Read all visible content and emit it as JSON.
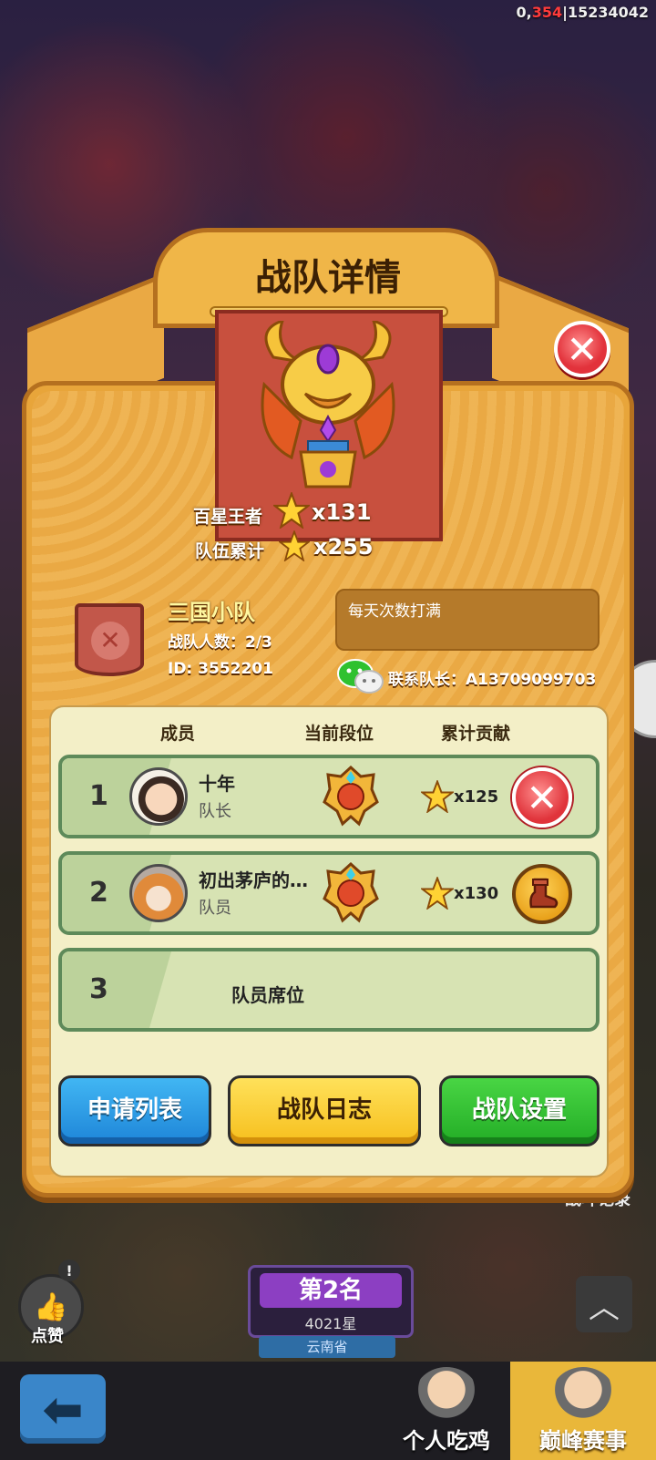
{
  "hud": {
    "counter_prefix": "0,",
    "counter_highlight": "354",
    "counter_suffix": "|15234042"
  },
  "dialog": {
    "title": "战队详情",
    "stats": [
      {
        "label": "百星王者",
        "value": "x131"
      },
      {
        "label": "队伍累计",
        "value": "x255"
      }
    ],
    "team": {
      "name": "三国小队",
      "member_count": "战队人数：2/3",
      "id": "ID: 3552201",
      "notice": "每天次数打满",
      "contact": "联系队长：A13709099703"
    },
    "columns": [
      "成员",
      "当前段位",
      "累计贡献"
    ],
    "members": [
      {
        "index": "1",
        "name": "十年",
        "role": "队长",
        "contribution": "x125",
        "action": "kick"
      },
      {
        "index": "2",
        "name": "初出茅庐的…",
        "role": "队员",
        "contribution": "x130",
        "action": "boot"
      }
    ],
    "empty_seat": {
      "index": "3",
      "label": "队员席位"
    },
    "buttons": {
      "apply_list": "申请列表",
      "team_log": "战队日志",
      "team_settings": "战队设置"
    }
  },
  "background": {
    "like_label": "点赞",
    "like_badge": "!",
    "rank_title": "第2名",
    "rank_stars": "4021星",
    "rank_province": "云南省",
    "record_label": "战斗记录",
    "tab_solo": "个人吃鸡",
    "tab_peak": "巅峰赛事"
  },
  "colors": {
    "accent_red": "#ff3b3b",
    "panel": "#eaa944",
    "button_blue": "#1e85d8",
    "button_yellow": "#f6bf1d",
    "button_green": "#23ad26"
  }
}
